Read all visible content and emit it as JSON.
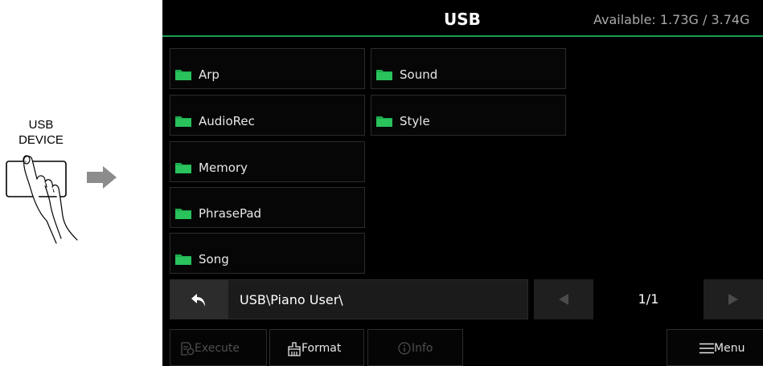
{
  "illustration": {
    "label_line1": "USB",
    "label_line2": "DEVICE",
    "icons": [
      "usb-device-button-icon",
      "pressing-hand-icon",
      "right-arrow-icon"
    ]
  },
  "screen": {
    "title": "USB",
    "available": "Available: 1.73G / 3.74G",
    "folders": [
      {
        "label": "Arp",
        "icon": "folder-icon"
      },
      {
        "label": "AudioRec",
        "icon": "folder-icon"
      },
      {
        "label": "Memory",
        "icon": "folder-icon"
      },
      {
        "label": "PhrasePad",
        "icon": "folder-icon"
      },
      {
        "label": "Song",
        "icon": "folder-icon"
      },
      {
        "label": "Sound",
        "icon": "folder-icon"
      },
      {
        "label": "Style",
        "icon": "folder-icon"
      }
    ],
    "path": "USB\\Piano User\\",
    "page": "1/1",
    "buttons": {
      "execute": "Execute",
      "format": "Format",
      "info": "Info",
      "menu": "Menu"
    }
  },
  "colors": {
    "accent_green": "#1d9c4e",
    "folder_green": "#1faa4f",
    "screen_bg": "#000000",
    "disabled_text": "#555555"
  }
}
